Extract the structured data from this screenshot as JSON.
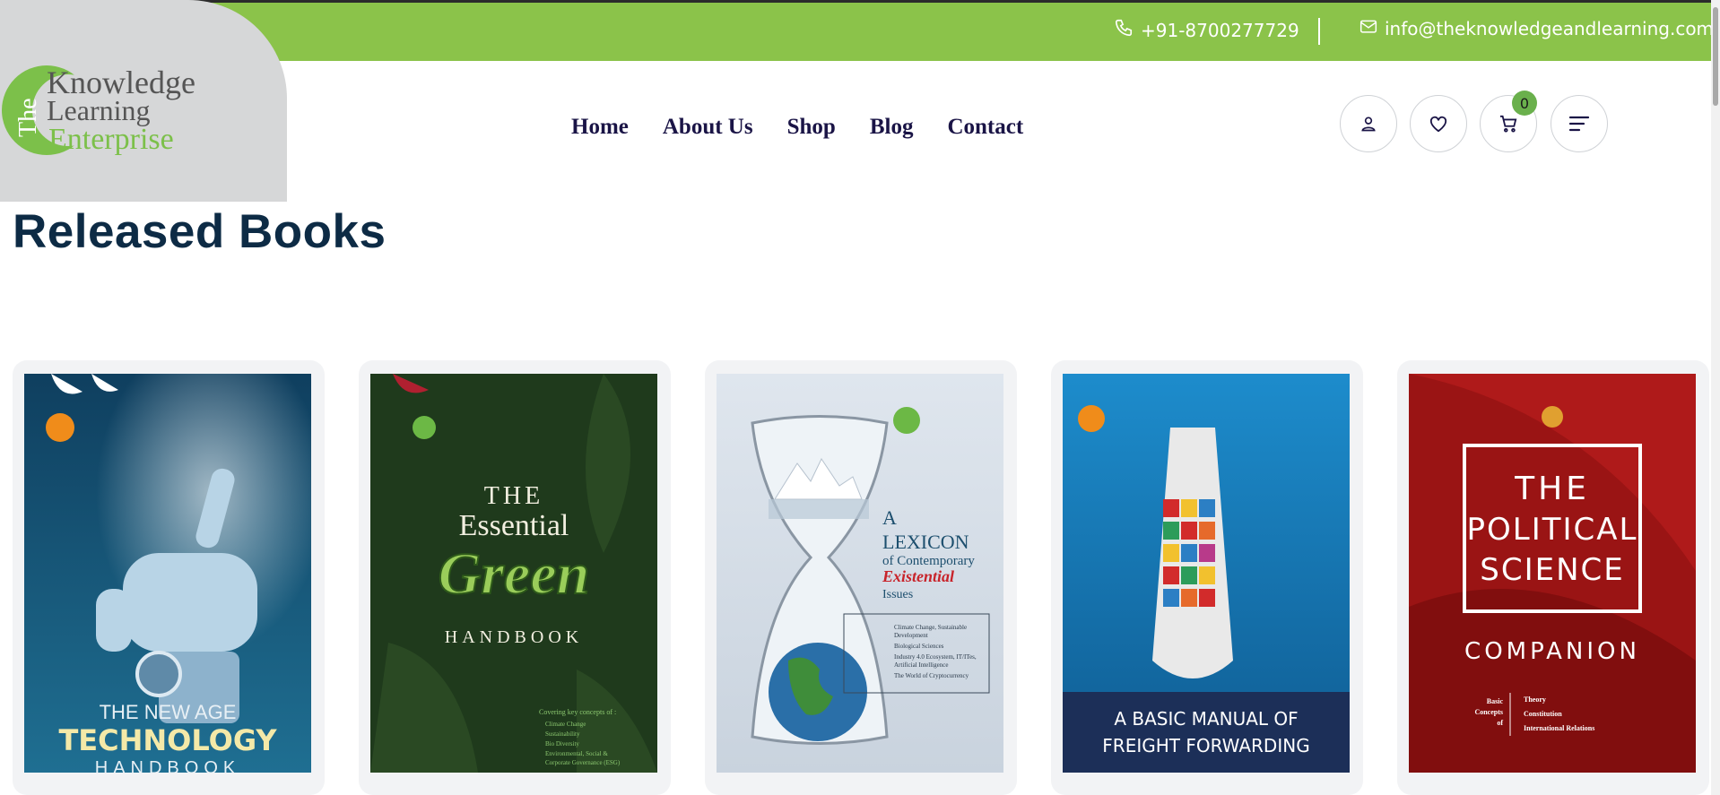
{
  "header": {
    "phone": "+91-8700277729",
    "email": "info@theknowledgeandlearning.com",
    "logo": {
      "line1": "Knowledge",
      "line2": "Learning",
      "line3": "Enterprise",
      "prefix": "The"
    },
    "cart_count": "0"
  },
  "nav": {
    "items": [
      {
        "label": "Home"
      },
      {
        "label": "About Us"
      },
      {
        "label": "Shop"
      },
      {
        "label": "Blog"
      },
      {
        "label": "Contact"
      }
    ]
  },
  "page": {
    "heading": "Released Books"
  },
  "books": [
    {
      "cover_lines": [
        "THE NEW AGE",
        "TECHNOLOGY",
        "HANDBOOK"
      ]
    },
    {
      "cover_lines": [
        "THE",
        "Essential",
        "Green",
        "HANDBOOK"
      ],
      "contents_label": "Covering key concepts of :",
      "contents": [
        "Climate Change",
        "Sustainability",
        "Bio Diversity",
        "Environmental, Social &",
        "Corporate Governance (ESG)"
      ]
    },
    {
      "cover_lines": [
        "A",
        "LEXICON",
        "of Contemporary",
        "Existential",
        "Issues"
      ],
      "contents": [
        "Climate Change, Sustainable",
        "Development",
        "Biological Sciences",
        "Industry 4.0 Ecosystem, IT/ITes,",
        "Artificial Intelligence",
        "The World of Cryptocurrency"
      ]
    },
    {
      "cover_lines": [
        "A BASIC MANUAL OF",
        "FREIGHT FORWARDING"
      ]
    },
    {
      "cover_lines": [
        "THE",
        "POLITICAL",
        "SCIENCE",
        "COMPANION"
      ],
      "concepts_label": [
        "Basic",
        "Concepts",
        "of"
      ],
      "concepts": [
        "Theory",
        "Constitution",
        "International Relations"
      ]
    }
  ],
  "colors": {
    "accent_green": "#8bc34a",
    "heading": "#0d2b45",
    "nav": "#1a1446",
    "logo_gray": "#d6d7d8"
  },
  "icons": [
    "phone-icon",
    "mail-icon",
    "user-icon",
    "heart-icon",
    "cart-icon",
    "menu-icon"
  ]
}
